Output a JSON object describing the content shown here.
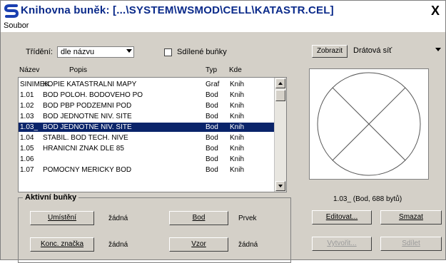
{
  "window": {
    "title": "Knihovna buněk: [...\\SYSTEM\\WSMOD\\CELL\\KATASTR.CEL]",
    "close_symbol": "X",
    "icon": "microstation-icon"
  },
  "menu": {
    "items": [
      "Soubor"
    ]
  },
  "filter": {
    "sort_label": "Třídění:",
    "sort_value": "dle názvu",
    "shared_label": "Sdílené buňky",
    "shared_checked": false
  },
  "view": {
    "show_button": "Zobrazit",
    "mode_value": "Drátová síť"
  },
  "list": {
    "columns": [
      "Název",
      "Popis",
      "Typ",
      "Kde"
    ],
    "rows": [
      {
        "name": "SINIMEK",
        "desc": "KOPIE KATASTRALNI MAPY",
        "type": "Graf",
        "where": "Knih",
        "selected": false
      },
      {
        "name": "1.01",
        "desc": "BOD POLOH. BODOVEHO PO",
        "type": "Bod",
        "where": "Knih",
        "selected": false
      },
      {
        "name": "1.02",
        "desc": "BOD PBP PODZEMNI POD",
        "type": "Bod",
        "where": "Knih",
        "selected": false
      },
      {
        "name": "1.03",
        "desc": "BOD JEDNOTNE NIV. SITE",
        "type": "Bod",
        "where": "Knih",
        "selected": false
      },
      {
        "name": "1.03_",
        "desc": "BOD JEDNOTNE NIV. SITE",
        "type": "Bod",
        "where": "Knih",
        "selected": true
      },
      {
        "name": "1.04",
        "desc": "STABIL. BOD TECH. NIVE",
        "type": "Bod",
        "where": "Knih",
        "selected": false
      },
      {
        "name": "1.05",
        "desc": "HRANICNI ZNAK DLE 85",
        "type": "Bod",
        "where": "Knih",
        "selected": false
      },
      {
        "name": "1.06",
        "desc": "",
        "type": "Bod",
        "where": "Knih",
        "selected": false
      },
      {
        "name": "1.07",
        "desc": "POMOCNY MERICKY BOD",
        "type": "Bod",
        "where": "Knih",
        "selected": false
      }
    ]
  },
  "active_cells": {
    "title": "Aktivní buňky",
    "placement_button": "Umístění",
    "placement_value": "žádná",
    "point_button": "Bod",
    "point_value": "Prvek",
    "terminator_button": "Konc. značka",
    "terminator_value": "žádná",
    "pattern_button": "Vzor",
    "pattern_value": "žádná"
  },
  "preview": {
    "caption": "1.03_ (Bod, 688 bytů)"
  },
  "actions": {
    "edit": "Editovat...",
    "delete": "Smazat",
    "create": "Vytvořit...",
    "share": "Sdílet"
  }
}
